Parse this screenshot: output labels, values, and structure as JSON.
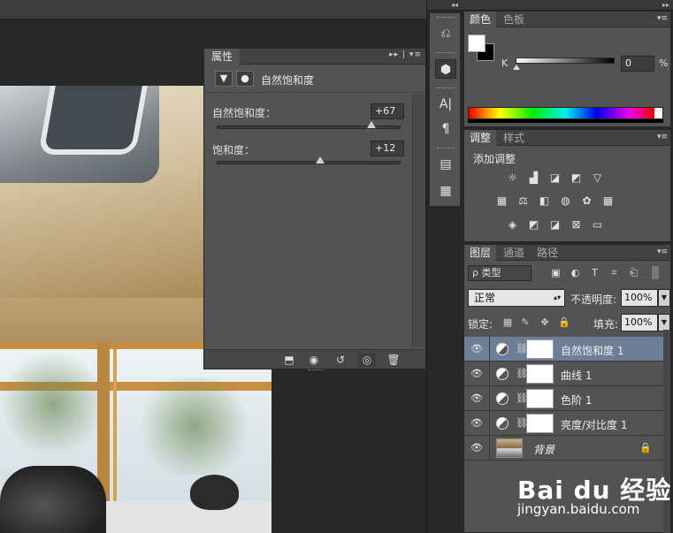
{
  "properties_panel": {
    "tab_label": "属性",
    "panel_controls": "▸▸ | ▾≡",
    "adjustment_name": "自然饱和度",
    "vibrance": {
      "label": "自然饱和度：",
      "value": "+67",
      "fraction": 0.835
    },
    "saturation": {
      "label": "饱和度：",
      "value": "+12",
      "fraction": 0.56
    },
    "footer_icons": [
      "clip-to-layer-icon",
      "view-previous-icon",
      "reset-icon",
      "visibility-icon",
      "delete-icon"
    ]
  },
  "tools": [
    "history-icon",
    "3d-icon",
    "character-icon",
    "paragraph-icon",
    "notes-icon",
    "brush-preset-icon"
  ],
  "color_panel": {
    "tabs": [
      "颜色",
      "色板"
    ],
    "channel_label": "K",
    "channel_value": "0",
    "channel_unit": "%",
    "channel_fraction": 0,
    "foreground": "#ffffff",
    "background": "#000000"
  },
  "adjustments_panel": {
    "tabs": [
      "调整",
      "样式"
    ],
    "title": "添加调整"
  },
  "layers_panel": {
    "tabs": [
      "图层",
      "通道",
      "路径"
    ],
    "filter_type": "ρ 类型",
    "blend_mode": "正常",
    "opacity_label": "不透明度:",
    "opacity_value": "100%",
    "lock_label": "锁定:",
    "fill_label": "填充:",
    "fill_value": "100%",
    "layers": [
      {
        "name": "自然饱和度 1",
        "selected": true
      },
      {
        "name": "曲线 1",
        "selected": false
      },
      {
        "name": "色阶 1",
        "selected": false
      },
      {
        "name": "亮度/对比度 1",
        "selected": false
      }
    ],
    "background_layer": "背景"
  },
  "watermark": {
    "logo": "Bai du 经验",
    "url": "jingyan.baidu.com"
  },
  "colors": {
    "panel_bg": "#535353",
    "selected_layer": "#6d7f96",
    "workspace": "#282828"
  }
}
